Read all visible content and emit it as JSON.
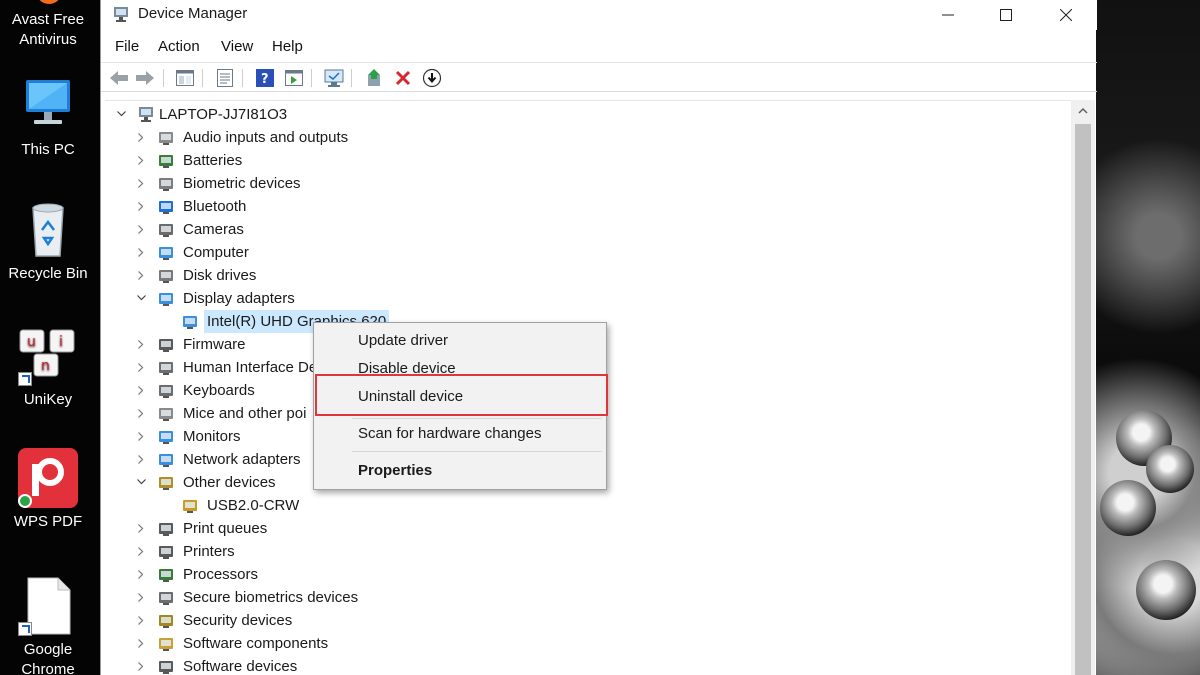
{
  "desktop": {
    "icons": [
      {
        "label_line1": "Avast Free",
        "label_line2": "Antivirus"
      },
      {
        "label_line1": "This PC",
        "label_line2": ""
      },
      {
        "label_line1": "Recycle Bin",
        "label_line2": ""
      },
      {
        "label_line1": "UniKey",
        "label_line2": ""
      },
      {
        "label_line1": "WPS PDF",
        "label_line2": ""
      },
      {
        "label_line1": "Google",
        "label_line2": "Chrome"
      }
    ]
  },
  "window": {
    "title": "Device Manager",
    "app_icon": "device-manager-icon"
  },
  "menubar": {
    "items": [
      "File",
      "Action",
      "View",
      "Help"
    ]
  },
  "toolbar": {
    "buttons": [
      "back-arrow-icon",
      "forward-arrow-icon",
      "show-hide-tree-icon",
      "properties-icon",
      "help-icon",
      "action-pane-icon",
      "scan-hardware-icon",
      "update-driver-icon",
      "uninstall-icon",
      "disable-icon"
    ]
  },
  "tree": {
    "root": "LAPTOP-JJ7I81O3",
    "nodes": [
      {
        "label": "Audio inputs and outputs",
        "expanded": false
      },
      {
        "label": "Batteries",
        "expanded": false
      },
      {
        "label": "Biometric devices",
        "expanded": false
      },
      {
        "label": "Bluetooth",
        "expanded": false
      },
      {
        "label": "Cameras",
        "expanded": false
      },
      {
        "label": "Computer",
        "expanded": false
      },
      {
        "label": "Disk drives",
        "expanded": false
      },
      {
        "label": "Display adapters",
        "expanded": true
      },
      {
        "label": "Intel(R) UHD Graphics 620",
        "child": true
      },
      {
        "label": "Firmware",
        "expanded": false
      },
      {
        "label": "Human Interface De",
        "expanded": false
      },
      {
        "label": "Keyboards",
        "expanded": false
      },
      {
        "label": "Mice and other poi",
        "expanded": false
      },
      {
        "label": "Monitors",
        "expanded": false
      },
      {
        "label": "Network adapters",
        "expanded": false
      },
      {
        "label": "Other devices",
        "expanded": true
      },
      {
        "label": "USB2.0-CRW",
        "child": true
      },
      {
        "label": "Print queues",
        "expanded": false
      },
      {
        "label": "Printers",
        "expanded": false
      },
      {
        "label": "Processors",
        "expanded": false
      },
      {
        "label": "Secure biometrics devices",
        "expanded": false
      },
      {
        "label": "Security devices",
        "expanded": false
      },
      {
        "label": "Software components",
        "expanded": false
      },
      {
        "label": "Software devices",
        "expanded": false
      }
    ]
  },
  "context_menu": {
    "items": [
      "Update driver",
      "Disable device",
      "Uninstall device",
      "Scan for hardware changes",
      "Properties"
    ],
    "highlighted": "Uninstall device"
  },
  "colors": {
    "highlight_border": "#e0353b",
    "selection": "#cce8ff"
  }
}
